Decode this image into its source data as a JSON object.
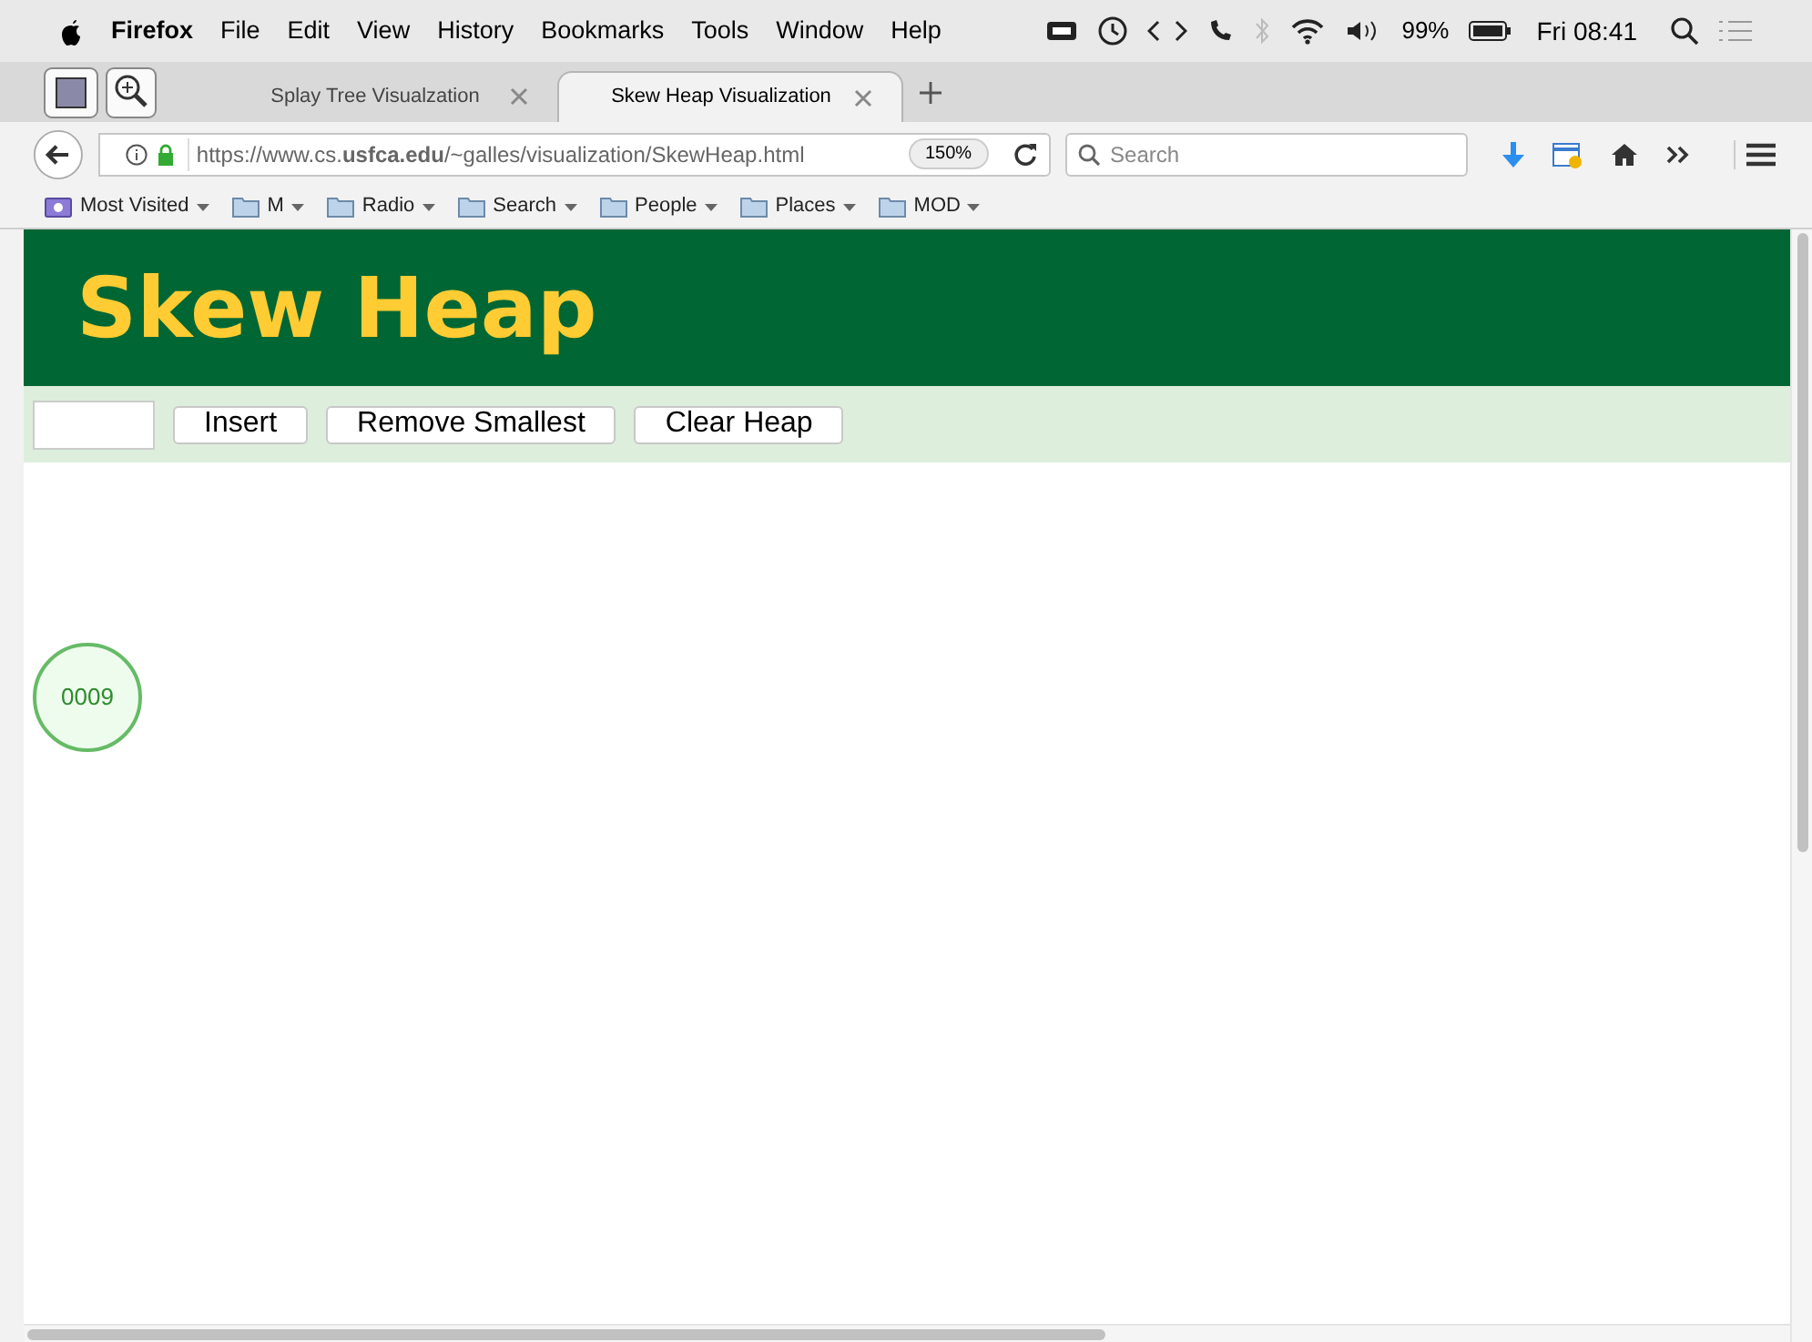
{
  "menu_bar": {
    "app": "Firefox",
    "items": [
      "File",
      "Edit",
      "View",
      "History",
      "Bookmarks",
      "Tools",
      "Window",
      "Help"
    ],
    "battery": "99%",
    "clock": "Fri 08:41"
  },
  "tabs": [
    {
      "label": "Splay Tree Visualzation",
      "selected": false
    },
    {
      "label": "Skew Heap Visualization",
      "selected": true
    }
  ],
  "nav_bar": {
    "url": "https://www.cs.**usfca.edu**/~galles/visualization/SkewHeap.html",
    "zoom": "150%",
    "search": {
      "placeholder": "Search"
    }
  },
  "bookmarks": [
    {
      "label": "Most Visited",
      "kind": "special"
    },
    {
      "label": "M",
      "kind": "folder"
    },
    {
      "label": "Radio",
      "kind": "folder"
    },
    {
      "label": "Search",
      "kind": "folder"
    },
    {
      "label": "People",
      "kind": "folder"
    },
    {
      "label": "Places",
      "kind": "folder"
    },
    {
      "label": "MOD",
      "kind": "folder"
    }
  ],
  "page": {
    "title": "Skew Heap",
    "controls": {
      "buttons": [
        "Insert",
        "Remove Smallest",
        "Clear Heap"
      ]
    },
    "nodes": [
      {
        "label": "0009"
      }
    ]
  }
}
